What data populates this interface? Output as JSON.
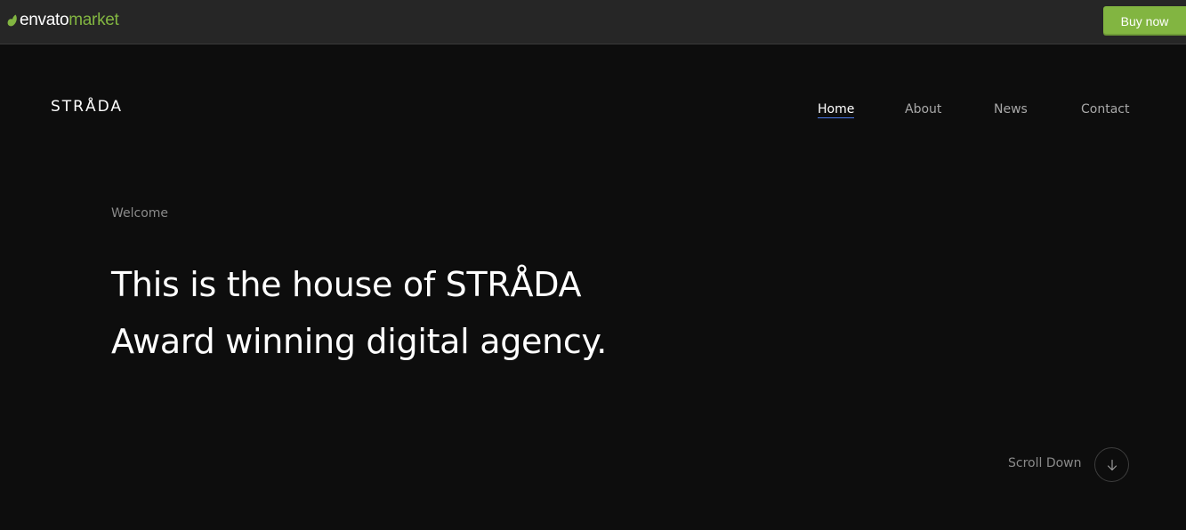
{
  "envato_bar": {
    "logo_word": "envato",
    "logo_suffix": "market",
    "buy_label": "Buy now",
    "accent_color": "#82b541"
  },
  "site": {
    "brand": "STRÅDA"
  },
  "nav": {
    "items": [
      {
        "label": "Home",
        "active": true
      },
      {
        "label": "About",
        "active": false
      },
      {
        "label": "News",
        "active": false
      },
      {
        "label": "Contact",
        "active": false
      }
    ]
  },
  "hero": {
    "eyebrow": "Welcome",
    "line1": "This is the house of STRÅDA",
    "line2": "Award winning digital agency."
  },
  "scroll": {
    "label": "Scroll Down",
    "icon": "arrow-down-icon"
  }
}
